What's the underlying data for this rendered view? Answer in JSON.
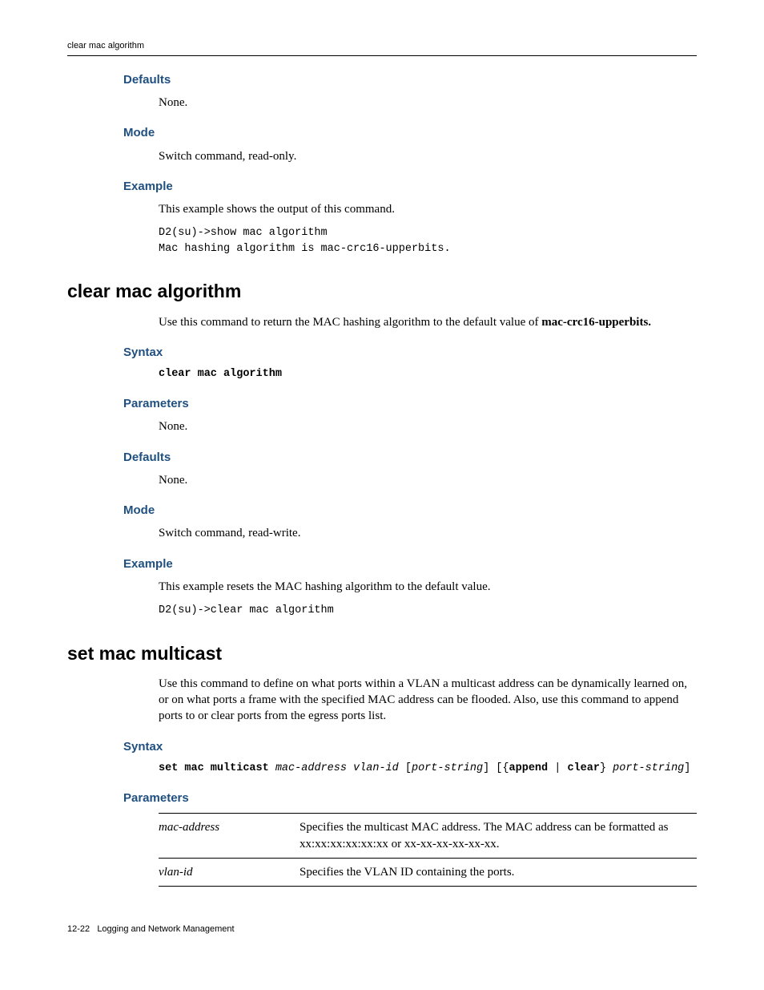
{
  "header": {
    "running_title": "clear mac algorithm"
  },
  "sec1": {
    "defaults": {
      "heading": "Defaults",
      "body": "None."
    },
    "mode": {
      "heading": "Mode",
      "body": "Switch command, read-only."
    },
    "example": {
      "heading": "Example",
      "body": "This example shows the output of this command.",
      "code": "D2(su)->show mac algorithm\nMac hashing algorithm is mac-crc16-upperbits."
    }
  },
  "cmd1": {
    "heading": "clear mac algorithm",
    "intro_pre": "Use this command to return the MAC hashing algorithm to the default value of ",
    "intro_bold": "mac-crc16-upperbits.",
    "syntax": {
      "heading": "Syntax",
      "code": "clear mac algorithm"
    },
    "parameters": {
      "heading": "Parameters",
      "body": "None."
    },
    "defaults": {
      "heading": "Defaults",
      "body": "None."
    },
    "mode": {
      "heading": "Mode",
      "body": "Switch command, read-write."
    },
    "example": {
      "heading": "Example",
      "body": "This example resets the MAC hashing algorithm to the default value.",
      "code": "D2(su)->clear mac algorithm"
    }
  },
  "cmd2": {
    "heading": "set mac multicast",
    "intro": "Use this command to define on what ports within a VLAN a multicast address can be dynamically learned on, or on what ports a frame with the specified MAC address can be flooded. Also, use this command to append ports to or clear ports from the egress ports list.",
    "syntax": {
      "heading": "Syntax",
      "t1": "set mac multicast",
      "t2": " mac-address vlan-id ",
      "t3": "[",
      "t4": "port-string",
      "t5": "] [{",
      "t6": "append",
      "t7": " | ",
      "t8": "clear",
      "t9": "} ",
      "t10": "port-string",
      "t11": "]"
    },
    "parameters": {
      "heading": "Parameters",
      "rows": [
        {
          "term": "mac-address",
          "desc": "Specifies the multicast MAC address. The MAC address can be formatted as xx:xx:xx:xx:xx:xx or xx-xx-xx-xx-xx-xx."
        },
        {
          "term": "vlan-id",
          "desc": "Specifies the VLAN ID containing the ports."
        }
      ]
    }
  },
  "footer": {
    "page": "12-22",
    "section": "Logging and Network Management"
  }
}
